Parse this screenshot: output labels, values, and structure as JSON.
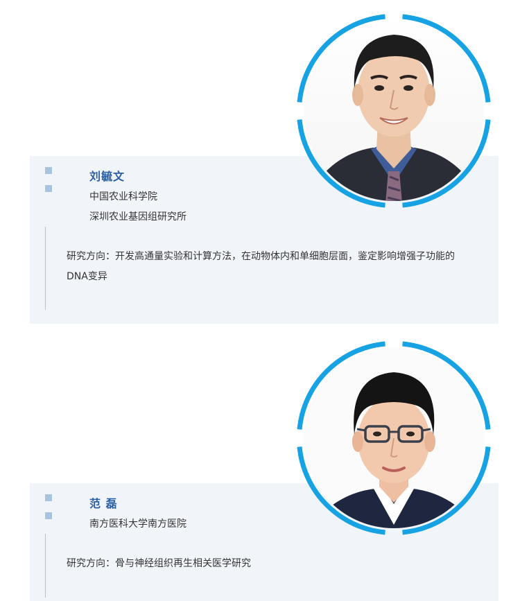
{
  "profiles": [
    {
      "name": "刘毓文",
      "affiliations": [
        "中国农业科学院",
        "深圳农业基因组研究所"
      ],
      "research": "研究方向：开发高通量实验和计算方法，在动物体内和单细胞层面，鉴定影响增强子功能的DNA变异",
      "photo_icon": "portrait-photo"
    },
    {
      "name": "范  磊",
      "affiliations": [
        "南方医科大学南方医院"
      ],
      "research": "研究方向：骨与神经组织再生相关医学研究",
      "photo_icon": "portrait-photo"
    }
  ],
  "colors": {
    "ring": "#17a3e3",
    "panel": "#f1f5fa",
    "name": "#2b5fa3",
    "marker": "#a8c3df"
  }
}
